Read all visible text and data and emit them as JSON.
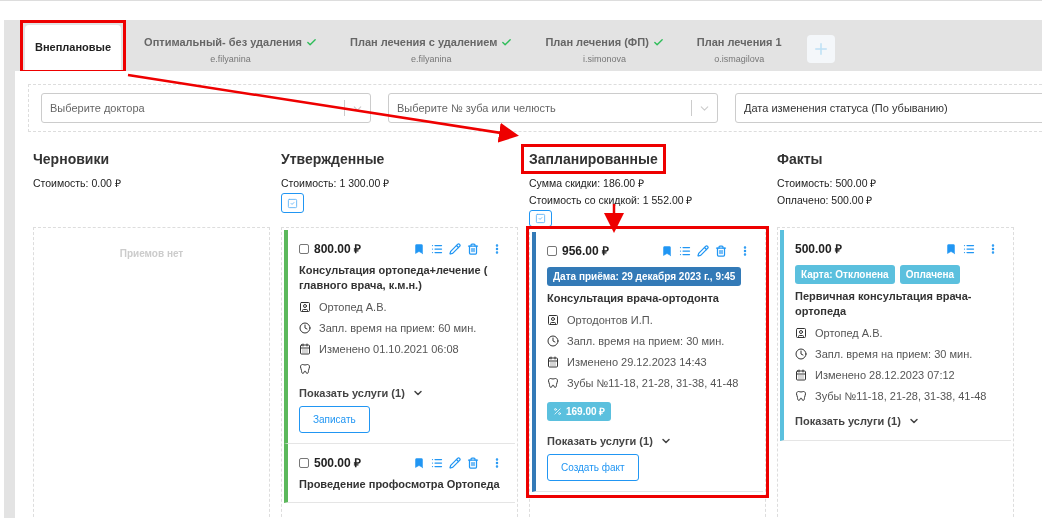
{
  "tabs": [
    {
      "label": "Внеплановые",
      "selected": true,
      "verified": false,
      "highlighted": true
    },
    {
      "label": "Оптимальный- без удаления",
      "user": "e.filyanina",
      "selected": false,
      "verified": true,
      "highlighted": false
    },
    {
      "label": "План лечения с удалением",
      "user": "e.filyanina",
      "selected": false,
      "verified": true,
      "highlighted": false
    },
    {
      "label": "План лечения (ФП)",
      "user": "i.simonova",
      "selected": false,
      "verified": true,
      "highlighted": false
    },
    {
      "label": "План лечения 1",
      "user": "o.ismagilova",
      "selected": false,
      "verified": false,
      "highlighted": false
    }
  ],
  "filters": [
    {
      "placeholder": "Выберите доктора"
    },
    {
      "placeholder": "Выберите № зуба или челюсть"
    },
    {
      "value": "Дата изменения статуса (По убыванию)"
    }
  ],
  "columns": [
    {
      "title": "Черновики",
      "highlighted": false,
      "stats": [
        "Стоимость: 0.00 ₽"
      ],
      "empty_text": "Приемов нет"
    },
    {
      "title": "Утвержденные",
      "highlighted": false,
      "stats": [
        "Стоимость: 1 300.00 ₽"
      ],
      "select_all": {
        "checked": true
      },
      "cards": [
        {
          "color": "#5cb85c",
          "highlighted": false,
          "checked": false,
          "price": "800.00 ₽",
          "editable": true,
          "title": "Консультация ортопеда+лечение ( главного врача, к.м.н.)",
          "doctor": "Ортопед А.В.",
          "time": "Запл. время на прием: 60 мин.",
          "changed": "Изменено 01.10.2021 06:08",
          "services": "Показать услуги (1)",
          "button": "Записать"
        },
        {
          "color": "#5cb85c",
          "highlighted": false,
          "checked": false,
          "price": "500.00 ₽",
          "editable": true,
          "title": "Проведение профосмотра Ортопеда"
        }
      ]
    },
    {
      "title": "Запланированные",
      "highlighted": true,
      "stats": [
        "Сумма скидки: 186.00 ₽",
        "Стоимость со скидкой: 1 552.00 ₽"
      ],
      "select_all": {
        "checked": true
      },
      "cards": [
        {
          "color": "#337ab7",
          "highlighted": true,
          "checked": false,
          "price": "956.00 ₽",
          "editable": true,
          "badges": [
            {
              "text": "Дата приёма: 29 декабря 2023 г., 9:45",
              "color": "#337ab7"
            }
          ],
          "title": "Консультация врача-ортодонта",
          "doctor": "Ортодонтов И.П.",
          "time": "Запл. время на прием: 30 мин.",
          "changed": "Изменено 29.12.2023 14:43",
          "teeth": "Зубы №11-18, 21-28, 31-38, 41-48",
          "discount": "169.00 ₽",
          "services": "Показать услуги (1)",
          "button": "Создать факт"
        }
      ]
    },
    {
      "title": "Факты",
      "highlighted": false,
      "stats": [
        "Стоимость: 500.00 ₽",
        "Оплачено: 500.00 ₽"
      ],
      "cards": [
        {
          "color": "#5bc0de",
          "highlighted": false,
          "price": "500.00 ₽",
          "editable": false,
          "badges": [
            {
              "text": "Карта: Отклонена",
              "color": "#5bc0de"
            },
            {
              "text": "Оплачена",
              "color": "#5bc0de"
            }
          ],
          "title": "Первичная консультация врача-ортопеда",
          "doctor": "Ортопед А.В.",
          "time": "Запл. время на прием: 30 мин.",
          "changed": "Изменено 28.12.2023 07:12",
          "teeth": "Зубы №11-18, 21-28, 31-38, 41-48",
          "services": "Показать услуги (1)"
        }
      ]
    }
  ]
}
